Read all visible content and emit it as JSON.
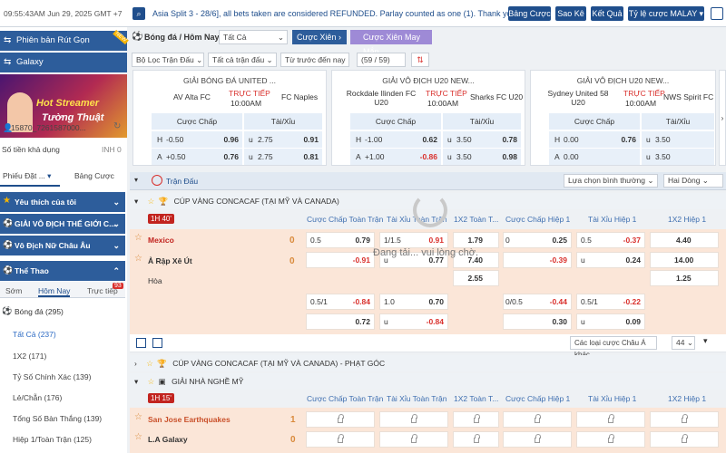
{
  "topbar": {
    "time": "09:55:43AM Jun 29, 2025 GMT +7",
    "marquee": "Asia Split 3 - 28/6], all bets taken are considered REFUNDED. Parlay counted as one (1). Thank you!",
    "buttons": [
      "Bảng Cược",
      "Sao Kê",
      "Kết Quả",
      "Tỷ lệ cược MALAY"
    ]
  },
  "sidebar": {
    "phien_ban": "Phiên bản Rút Gọn",
    "galaxy": "Galaxy",
    "banner_l1": "Hot Streamer",
    "banner_l2": "Tường Thuật",
    "account": "15870_7261587000...",
    "balance_label": "Số tiền khả dụng",
    "balance_value": "INH 0",
    "tabs": [
      "Phiếu Đặt ...",
      "Bảng Cược"
    ],
    "sections": [
      "Yêu thích của tôi",
      "GIẢI VÔ ĐỊCH THẾ GIỚI C...",
      "Vô Địch Nữ Châu Âu",
      "Thể Thao"
    ],
    "sport_tabs": [
      "Sớm",
      "Hôm Nay",
      "Trực tiếp"
    ],
    "live_count": "93",
    "sport": "Bóng đá (295)",
    "items": [
      "Tất Cả (237)",
      "1X2 (171)",
      "Tỷ Số Chính Xác (139)",
      "Lẻ/Chẵn (176)",
      "Tổng Số Bàn Thắng (139)",
      "Hiệp 1/Toàn Trận (125)"
    ]
  },
  "main": {
    "title": "Bóng đá / Hôm Nay",
    "filter": "Tất Cả",
    "btn_cuoc_xien": "Cược Xiên",
    "btn_may_man": "Cược Xiên May Mắn",
    "filters": [
      "Bộ Lọc Trận Đấu",
      "Tất cả trận đấu",
      "Từ trước đến nay"
    ],
    "games": "(59 / 59) Giải",
    "cards": [
      {
        "title": "GIẢI BÓNG ĐÁ UNITED ...",
        "home": "AV Alta FC",
        "away": "FC Naples",
        "live": "TRỰC TIẾP",
        "time": "10:00AM",
        "h_label": "Cược Chấp",
        "ou_label": "Tài/Xỉu",
        "r1": [
          "H",
          "-0.50",
          "0.96",
          "u",
          "2.75",
          "0.91"
        ],
        "r2": [
          "A",
          "+0.50",
          "0.76",
          "u",
          "2.75",
          "0.81"
        ]
      },
      {
        "title": "GIẢI VÔ ĐỊCH U20 NEW...",
        "home": "Rockdale Ilinden FC U20",
        "away": "Sharks FC U20",
        "live": "TRỰC TIẾP",
        "time": "10:00AM",
        "h_label": "Cược Chấp",
        "ou_label": "Tài/Xỉu",
        "r1": [
          "H",
          "-1.00",
          "0.62",
          "u",
          "3.50",
          "0.78"
        ],
        "r2": [
          "A",
          "+1.00",
          "-0.86",
          "u",
          "3.50",
          "0.98"
        ]
      },
      {
        "title": "GIẢI VÔ ĐỊCH U20 NEW...",
        "home": "Sydney United 58 U20",
        "away": "NWS Spirit FC",
        "live": "TRỰC TIẾP",
        "time": "10:00AM",
        "h_label": "Cược Chấp",
        "ou_label": "Tài/Xỉu",
        "r1": [
          "H",
          "0.00",
          "0.76",
          "u",
          "3.50",
          ""
        ],
        "r2": [
          "A",
          "0.00",
          "",
          "u",
          "3.50",
          ""
        ]
      }
    ],
    "strip_label": "Trận Đấu",
    "sort": "Lựa chọn bình thường",
    "rows_mode": "Hai Dòng",
    "cols": [
      "Cược Chấp Toàn Trận",
      "Tài Xỉu Toàn Trận",
      "1X2 Toàn T...",
      "Cược Chấp Hiệp 1",
      "Tài Xỉu Hiệp 1",
      "1X2 Hiệp 1"
    ],
    "league1": "CÚP VÀNG CONCACAF (TẠI MỸ VÀ CANADA)",
    "half1": "1H",
    "min1": "40'",
    "m1": {
      "home": "Mexico",
      "away": "Ả Rập Xê Út",
      "draw": "Hòa",
      "sh": "0",
      "sa": "0",
      "r1": [
        "0.5",
        "0.79",
        "1/1.5",
        "0.91",
        "1.79",
        "0",
        "0.25",
        "0.5",
        "-0.37",
        "4.40"
      ],
      "r2": [
        "-0.91",
        "0.77",
        "7.40",
        "-0.39",
        "u",
        "0.24",
        "14.00"
      ],
      "r3": [
        "2.55",
        "1.25"
      ],
      "r4": [
        "0.5/1",
        "-0.84",
        "1.0",
        "0.70",
        "0/0.5",
        "-0.44",
        "0.5/1",
        "-0.22"
      ],
      "r5": [
        "0.72",
        "u",
        "-0.84",
        "0.30",
        "u",
        "0.09"
      ]
    },
    "loading": "Đang tải... vui lòng chờ.",
    "more": "Các loại cược Châu Á khác",
    "count44": "44",
    "league2": "CÚP VÀNG CONCACAF (TẠI MỸ VÀ CANADA) - PHẠT GÓC",
    "league3": "GIẢI NHÀ NGHỀ MỸ",
    "half2": "1H",
    "min2": "15'",
    "m2": {
      "home": "San Jose Earthquakes",
      "away": "L.A Galaxy",
      "sh": "1",
      "sa": "0"
    }
  },
  "colors": {
    "primary": "#1f4e8c",
    "live": "#d9302c",
    "row_bg": "#fbe6d8"
  }
}
